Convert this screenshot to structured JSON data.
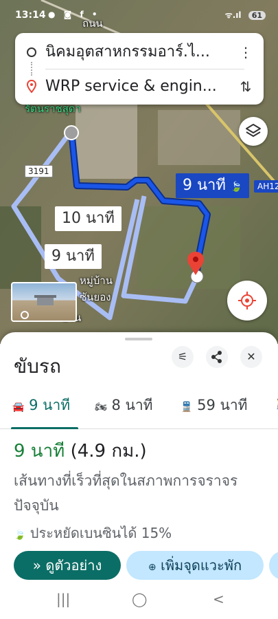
{
  "status_bar": {
    "time": "13:14",
    "icons": "● ◙ f •",
    "signal": "ᯤ.ıl",
    "battery": "61"
  },
  "search": {
    "origin": "นิคมอุตสาหกรรมอาร์.ไ...",
    "destination": "WRP service & engin...",
    "more_icon": "⋮",
    "swap_icon": "⇅"
  },
  "map": {
    "labels": {
      "route_10": "10 นาที",
      "route_9_alt": "9 นาที",
      "route_9_main": "9 นาที"
    },
    "road_3191": "3191",
    "road_ah": "AH12",
    "place_village": "หมู่บ้าน",
    "place_village2": "ซันยอง",
    "place_village3": "บ้าน",
    "place_top": "รัตนราชสุดา",
    "route_color": "#1a47c2",
    "alt_route_color": "#a9bdf5"
  },
  "sheet": {
    "title": "ขับรถ",
    "tabs": [
      {
        "icon": "🚘",
        "label": "9 นาที"
      },
      {
        "icon": "🏍",
        "label": "8 นาที"
      },
      {
        "icon": "🚆",
        "label": "59 นาที"
      },
      {
        "icon": "🚶",
        "label": ""
      }
    ],
    "summary_duration": "9 นาที",
    "summary_distance": "(4.9 กม.)",
    "description": "เส้นทางที่เร็วที่สุดในสภาพการจราจรปัจจุบัน",
    "saving": "ประหยัดเบนซินได้ 15%",
    "preview_button": "ดูตัวอย่าง",
    "add_stop_button": "เพิ่มจุดแวะพัก",
    "accent_color": "#0b6e66"
  },
  "navbar": {
    "recent": "|||",
    "home": "◯",
    "back": "<"
  }
}
